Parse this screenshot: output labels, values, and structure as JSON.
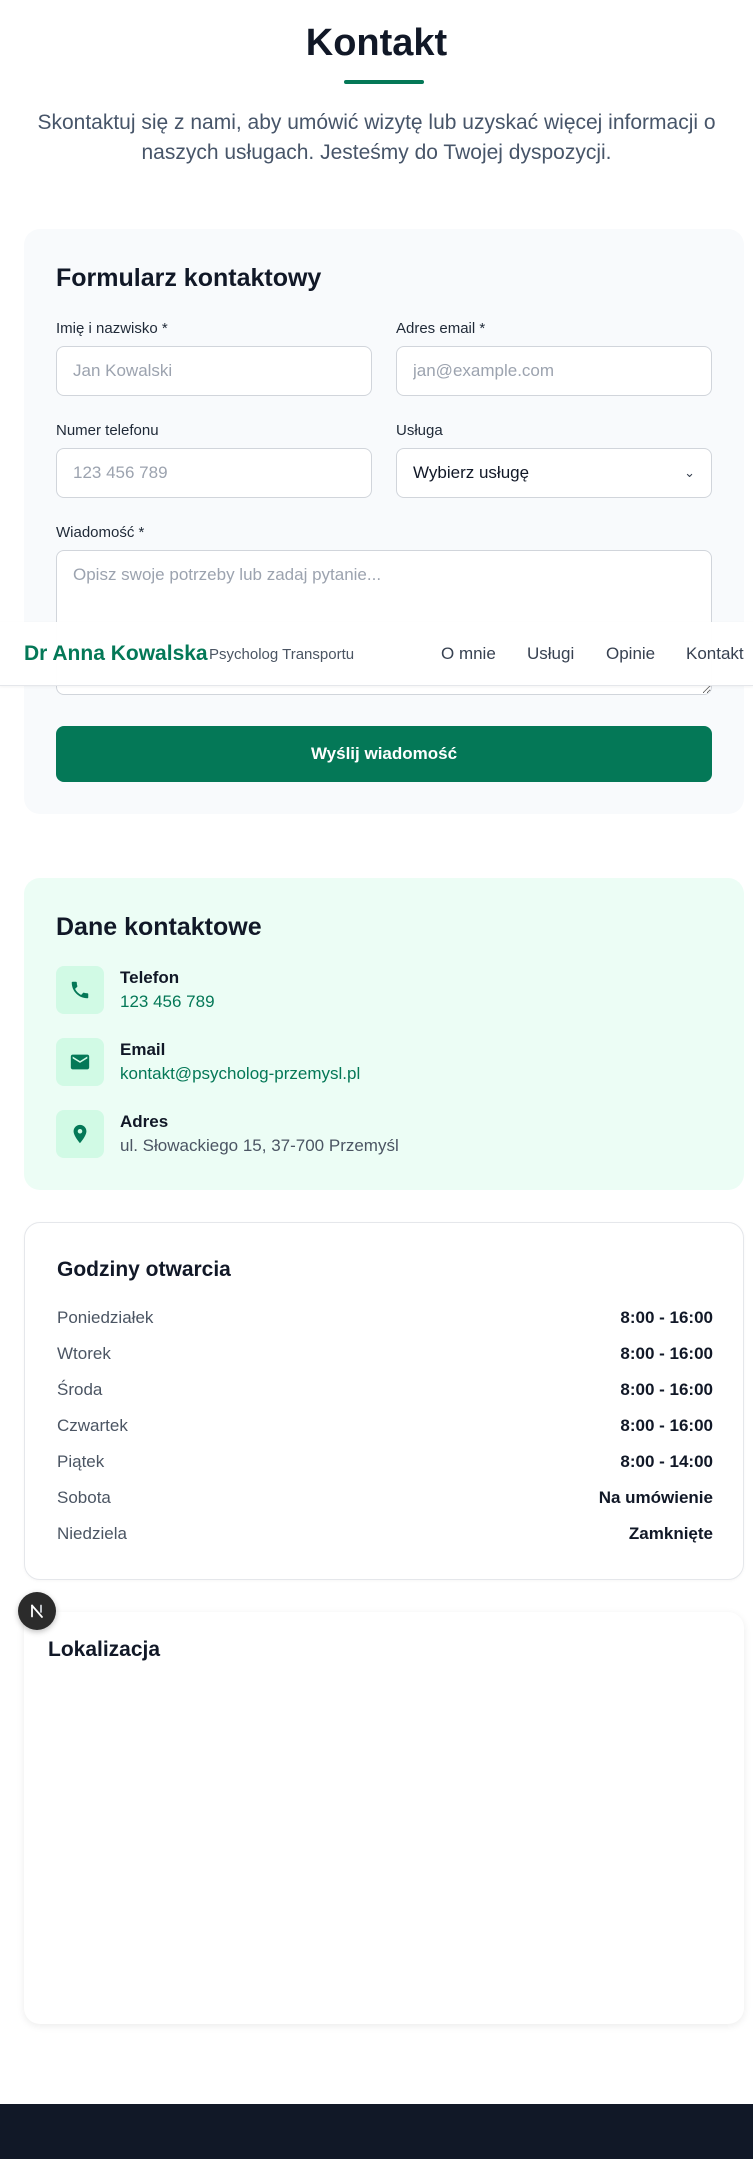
{
  "page": {
    "title": "Kontakt",
    "intro": "Skontaktuj się z nami, aby umówić wizytę lub uzyskać więcej informacji o naszych usługach. Jesteśmy do Twojej dyspozycji."
  },
  "nav": {
    "brand": "Dr Anna Kowalska",
    "subtitle": "Psycholog Transportu",
    "links": [
      "O mnie",
      "Usługi",
      "Opinie",
      "Kontakt"
    ]
  },
  "form": {
    "title": "Formularz kontaktowy",
    "name": {
      "label": "Imię i nazwisko *",
      "placeholder": "Jan Kowalski"
    },
    "email": {
      "label": "Adres email *",
      "placeholder": "jan@example.com"
    },
    "phone": {
      "label": "Numer telefonu",
      "placeholder": "123 456 789"
    },
    "service": {
      "label": "Usługa",
      "selected": "Wybierz usługę"
    },
    "message": {
      "label": "Wiadomość *",
      "placeholder": "Opisz swoje potrzeby lub zadaj pytanie..."
    },
    "submit": "Wyślij wiadomość"
  },
  "contact": {
    "title": "Dane kontaktowe",
    "phone": {
      "label": "Telefon",
      "value": "123 456 789",
      "icon": "phone-icon"
    },
    "email": {
      "label": "Email",
      "value": "kontakt@psycholog-przemysl.pl",
      "icon": "mail-icon"
    },
    "address": {
      "label": "Adres",
      "value": "ul. Słowackiego 15, 37-700 Przemyśl",
      "icon": "map-pin-icon"
    }
  },
  "hours": {
    "title": "Godziny otwarcia",
    "rows": [
      {
        "day": "Poniedziałek",
        "time": "8:00 - 16:00"
      },
      {
        "day": "Wtorek",
        "time": "8:00 - 16:00"
      },
      {
        "day": "Środa",
        "time": "8:00 - 16:00"
      },
      {
        "day": "Czwartek",
        "time": "8:00 - 16:00"
      },
      {
        "day": "Piątek",
        "time": "8:00 - 14:00"
      },
      {
        "day": "Sobota",
        "time": "Na umówienie"
      },
      {
        "day": "Niedziela",
        "time": "Zamknięte"
      }
    ]
  },
  "map": {
    "title": "Lokalizacja"
  },
  "badge": {
    "letter": "N"
  },
  "colors": {
    "accent": "#047857",
    "accent_light": "#d1fae5",
    "contact_bg": "#ecfdf5",
    "form_bg": "#f8fafc",
    "footer_bg": "#111827"
  }
}
